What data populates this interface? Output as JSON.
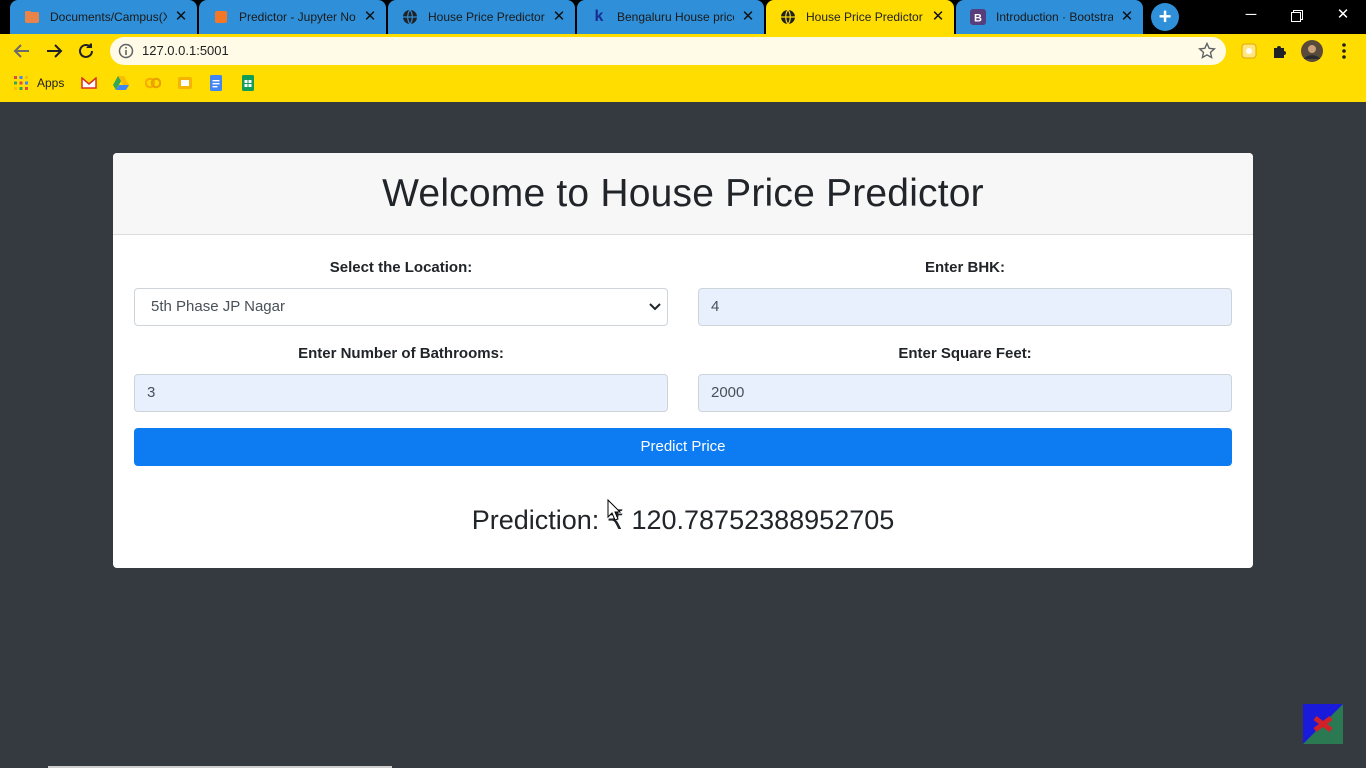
{
  "tabs": [
    {
      "title": "Documents/Campus(X)",
      "icon": "campusx-folder-icon"
    },
    {
      "title": "Predictor - Jupyter Notebook",
      "icon": "jupyter-icon"
    },
    {
      "title": "House Price Predictor",
      "icon": "globe-icon"
    },
    {
      "title": "Bengaluru House price",
      "icon": "kaggle-icon"
    },
    {
      "title": "House Price Predictor",
      "icon": "globe-icon"
    },
    {
      "title": "Introduction · Bootstrap",
      "icon": "bootstrap-icon"
    }
  ],
  "active_tab_index": 4,
  "address_bar": {
    "url": "127.0.0.1:5001"
  },
  "bookmarks": {
    "apps_label": "Apps"
  },
  "page": {
    "title": "Welcome to House Price Predictor",
    "location_label": "Select the Location:",
    "location_value": "5th Phase JP Nagar",
    "bhk_label": "Enter BHK:",
    "bhk_value": "4",
    "bathrooms_label": "Enter Number of Bathrooms:",
    "bathrooms_value": "3",
    "sqft_label": "Enter Square Feet:",
    "sqft_value": "2000",
    "predict_button": "Predict Price",
    "prediction_text": "Prediction: ₹ 120.78752388952705"
  },
  "colors": {
    "chrome": "#ffdd00",
    "tab_inactive": "#2f8fd8",
    "page_background": "#343a40",
    "button_primary": "#0d7bf2",
    "input_autofill": "#e8f0fe"
  }
}
